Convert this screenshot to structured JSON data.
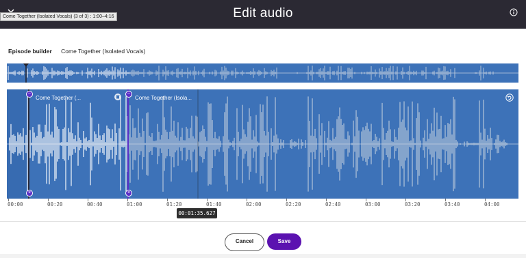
{
  "header": {
    "title": "Edit audio",
    "tooltip": "Come Together (Isolated Vocals) (3 of 3) : 1:00–4:16"
  },
  "breadcrumb": {
    "label": "Episode builder",
    "value": "Come Together (Isolated Vocals)"
  },
  "clips": [
    {
      "title": "Come Together (..."
    },
    {
      "title": "Come Together (Isola..."
    }
  ],
  "timeline": {
    "ticks": [
      "00:00",
      "00:20",
      "00:40",
      "01:00",
      "01:20",
      "01:40",
      "02:00",
      "02:20",
      "02:40",
      "03:00",
      "03:20",
      "03:40",
      "04:00"
    ],
    "current_time": "00:01:35.627"
  },
  "footer": {
    "cancel_label": "Cancel",
    "save_label": "Save"
  },
  "icons": {
    "info": "info-icon",
    "undo": "undo-icon",
    "trash": "trash-icon",
    "back": "chevron-down-icon"
  },
  "colors": {
    "topbar": "#2b2933",
    "waveform_bg": "#3d72b8",
    "save_button": "#5b12b0",
    "handle": "#5b2fc7"
  }
}
